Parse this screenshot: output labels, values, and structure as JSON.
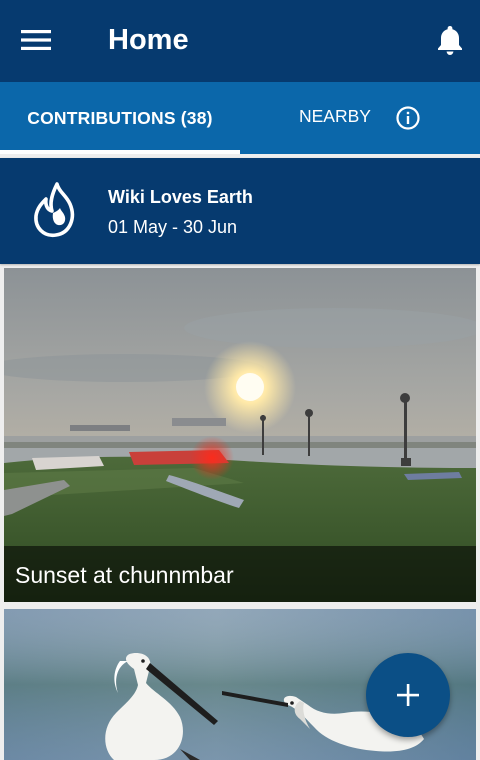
{
  "toolbar": {
    "title": "Home",
    "menu_icon": "menu-icon",
    "notifications_icon": "bell-icon"
  },
  "tabs": [
    {
      "label": "CONTRIBUTIONS (38)",
      "selected": true
    },
    {
      "label": "NEARBY",
      "selected": false,
      "icon": "info-icon"
    }
  ],
  "campaign": {
    "name": "Wiki Loves Earth",
    "dates": "01 May - 30 Jun",
    "icon": "wiki-loves-earth-icon"
  },
  "contributions": [
    {
      "caption": "Sunset at chunnmbar"
    },
    {
      "caption": ""
    }
  ],
  "fab": {
    "icon": "plus-icon"
  },
  "colors": {
    "toolbar": "#063a6f",
    "tab_bar": "#0b67aa",
    "campaign_card": "#063a6f",
    "fab": "#0b4f86"
  }
}
